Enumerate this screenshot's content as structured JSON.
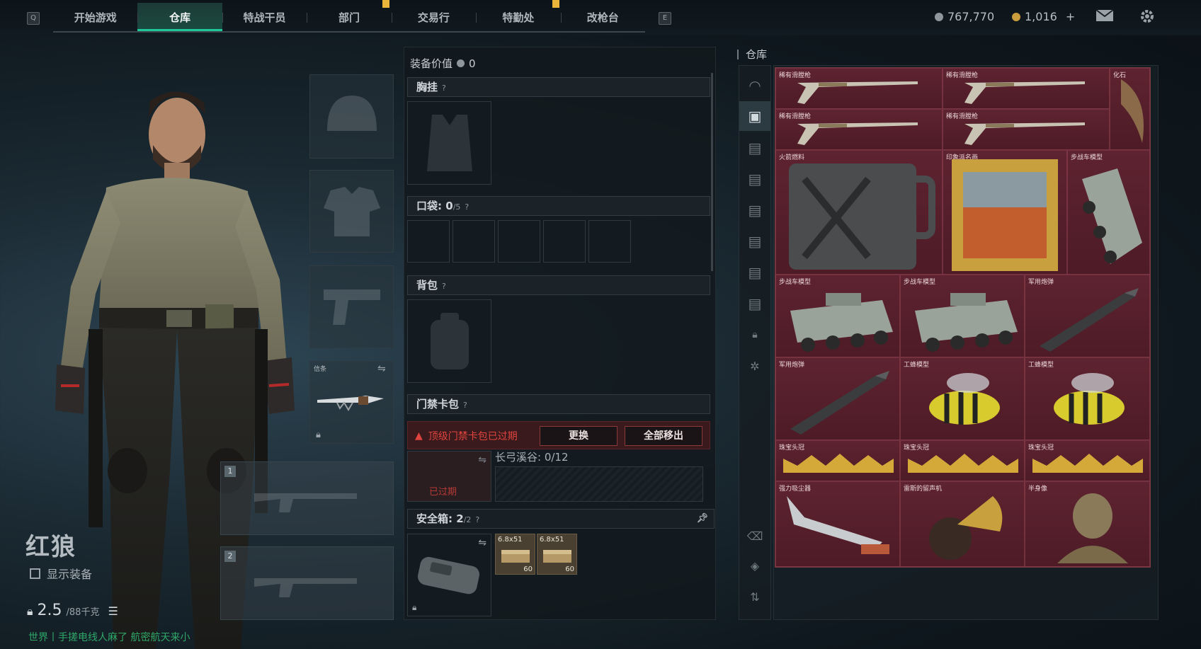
{
  "topbar": {
    "key_left": "Q",
    "key_right": "E",
    "tabs": [
      "开始游戏",
      "仓库",
      "特战干员",
      "部门",
      "交易行",
      "特勤处",
      "改枪台"
    ],
    "active_tab": "仓库",
    "currency_1": "767,770",
    "currency_2": "1,016",
    "currency_plus": "+",
    "colors": {
      "accent": "#1fc79a",
      "alert": "#e0443e",
      "item_bg": "#5a1e29"
    }
  },
  "character": {
    "name": "红狼",
    "show_gear_label": "显示装备",
    "weight_value": "2.5",
    "weight_max": "/88千克",
    "melee_label": "信条",
    "weapon_slot_1": "1",
    "weapon_slot_2": "2",
    "chat_line": "世界丨手搓电线人麻了 航密航天来小"
  },
  "equipment": {
    "value_label": "装备价值",
    "value": "0",
    "chest_rig_label": "胸挂",
    "pockets_label": "口袋",
    "pockets_count": "0",
    "pockets_max": "/5",
    "backpack_label": "背包",
    "keycard_label": "门禁卡包",
    "alert_text": "顶级门禁卡包已过期",
    "replace_button": "更换",
    "remove_all_button": "全部移出",
    "expired_badge": "已过期",
    "keycard_zone": "长弓溪谷: 0/12",
    "safebox_label": "安全箱",
    "safebox_count": "2",
    "safebox_max": "/2",
    "ammo": [
      {
        "label": "6.8x51",
        "count": "60"
      },
      {
        "label": "6.8x51",
        "count": "60"
      }
    ]
  },
  "warehouse": {
    "title": "仓库",
    "items": [
      {
        "label": "稀有滑膛枪",
        "icon": "musket-icon"
      },
      {
        "label": "稀有滑膛枪",
        "icon": "musket-icon"
      },
      {
        "label": "化石",
        "icon": "fossil-claw-icon"
      },
      {
        "label": "稀有滑膛枪",
        "icon": "musket-icon"
      },
      {
        "label": "稀有滑膛枪",
        "icon": "musket-icon"
      },
      {
        "label": "火箭燃料",
        "icon": "fuel-can-icon"
      },
      {
        "label": "印象派名画",
        "icon": "painting-icon"
      },
      {
        "label": "步战车模型",
        "icon": "ifv-model-icon"
      },
      {
        "label": "步战车模型",
        "icon": "ifv-model-icon"
      },
      {
        "label": "步战车模型",
        "icon": "ifv-model-icon"
      },
      {
        "label": "军用炮弹",
        "icon": "missile-icon"
      },
      {
        "label": "军用炮弹",
        "icon": "missile-icon"
      },
      {
        "label": "工蜂模型",
        "icon": "bee-model-icon"
      },
      {
        "label": "工蜂模型",
        "icon": "bee-model-icon"
      },
      {
        "label": "珠宝头冠",
        "icon": "crown-icon"
      },
      {
        "label": "珠宝头冠",
        "icon": "crown-icon"
      },
      {
        "label": "珠宝头冠",
        "icon": "crown-icon"
      },
      {
        "label": "强力吸尘器",
        "icon": "vacuum-icon"
      },
      {
        "label": "雷斯的留声机",
        "icon": "gramophone-icon"
      },
      {
        "label": "半身像",
        "icon": "bust-icon"
      }
    ]
  }
}
